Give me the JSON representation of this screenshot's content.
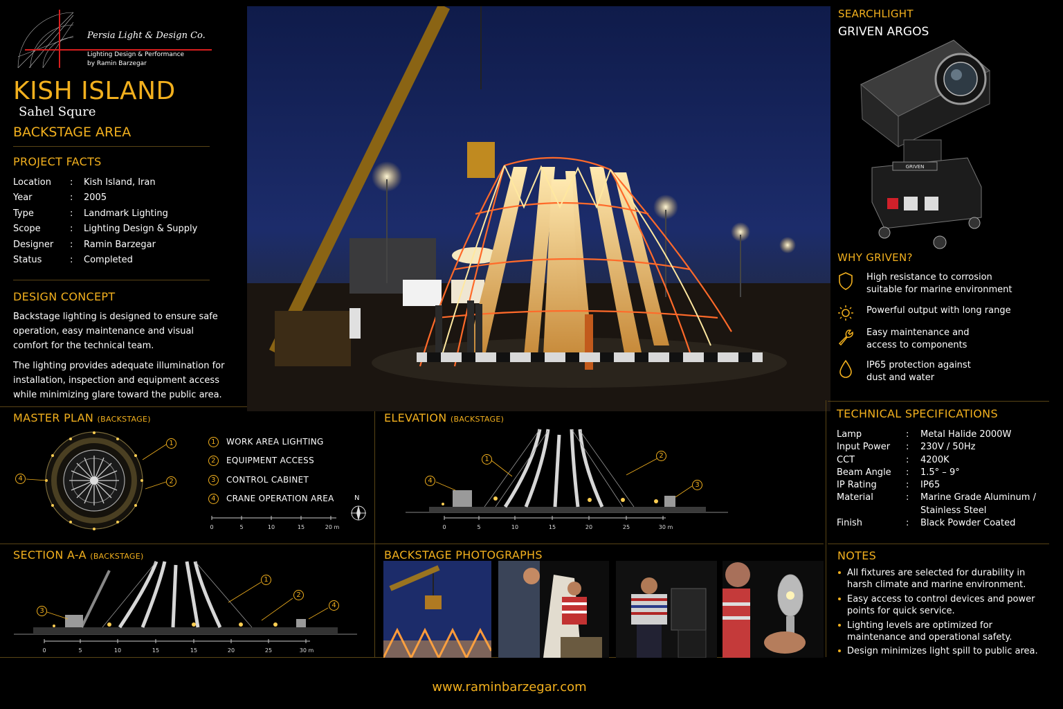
{
  "logo": {
    "company": "Persia Light & Design Co.",
    "tagline1": "Lighting Design & Performance",
    "tagline2": "by Ramin Barzegar"
  },
  "project": {
    "title": "KISH ISLAND",
    "subtitle": "Sahel Squre",
    "area": "BACKSTAGE AREA"
  },
  "facts": {
    "heading": "PROJECT FACTS",
    "rows": [
      {
        "key": "Location",
        "value": "Kish Island, Iran"
      },
      {
        "key": "Year",
        "value": "2005"
      },
      {
        "key": "Type",
        "value": "Landmark Lighting"
      },
      {
        "key": "Scope",
        "value": "Lighting Design & Supply"
      },
      {
        "key": "Designer",
        "value": "Ramin Barzegar"
      },
      {
        "key": "Status",
        "value": "Completed"
      }
    ]
  },
  "concept": {
    "heading": "DESIGN CONCEPT",
    "p1": "Backstage lighting is designed to ensure safe operation, easy maintenance and visual comfort for the technical team.",
    "p2": "The lighting provides adequate illumination for installation, inspection and equipment access while minimizing glare toward the public area."
  },
  "product": {
    "category": "SEARCHLIGHT",
    "name": "GRIVEN ARGOS",
    "brand_mark": "GRIVEN"
  },
  "why": {
    "heading": "WHY GRIVEN?",
    "items": [
      {
        "icon": "shield-icon",
        "l1": "High resistance to corrosion",
        "l2": "suitable for marine environment"
      },
      {
        "icon": "sun-icon",
        "l1": "Powerful output with long range",
        "l2": ""
      },
      {
        "icon": "wrench-icon",
        "l1": "Easy maintenance and",
        "l2": "access to components"
      },
      {
        "icon": "water-drop-icon",
        "l1": "IP65 protection against",
        "l2": "dust and water"
      }
    ]
  },
  "specs": {
    "heading": "TECHNICAL SPECIFICATIONS",
    "rows": [
      {
        "key": "Lamp",
        "value": "Metal Halide 2000W"
      },
      {
        "key": "Input Power",
        "value": "230V / 50Hz"
      },
      {
        "key": "CCT",
        "value": "4200K"
      },
      {
        "key": "Beam Angle",
        "value": "1.5° – 9°"
      },
      {
        "key": "IP Rating",
        "value": "IP65"
      },
      {
        "key": "Material",
        "value": "Marine Grade Aluminum / Stainless Steel"
      },
      {
        "key": "Finish",
        "value": "Black Powder Coated"
      }
    ]
  },
  "notes": {
    "heading": "NOTES",
    "items": [
      "All fixtures are selected for durability in harsh climate and marine environment.",
      "Easy access to control devices and power points for quick service.",
      "Lighting levels are optimized for maintenance and operational safety.",
      "Design minimizes light spill to public area."
    ]
  },
  "master_plan": {
    "heading": "MASTER PLAN",
    "tag": "(BACKSTAGE)",
    "north": "N",
    "callouts": [
      "1",
      "2",
      "4"
    ],
    "legend": [
      {
        "num": "1",
        "label": "WORK AREA LIGHTING"
      },
      {
        "num": "2",
        "label": "EQUIPMENT ACCESS"
      },
      {
        "num": "3",
        "label": "CONTROL CABINET"
      },
      {
        "num": "4",
        "label": "CRANE OPERATION AREA"
      }
    ],
    "scale": [
      "0",
      "5",
      "10",
      "15",
      "20 m"
    ]
  },
  "elevation": {
    "heading": "ELEVATION",
    "tag": "(BACKSTAGE)",
    "callouts": [
      "1",
      "2",
      "4",
      "3"
    ],
    "scale": [
      "0",
      "5",
      "10",
      "15",
      "20",
      "25",
      "30 m"
    ]
  },
  "section": {
    "heading": "SECTION A-A",
    "tag": "(BACKSTAGE)",
    "callouts": [
      "1",
      "2",
      "3",
      "4"
    ],
    "scale": [
      "0",
      "5",
      "10",
      "15",
      "15",
      "20",
      "25",
      "30 m"
    ]
  },
  "photos": {
    "heading": "BACKSTAGE PHOTOGRAPHS"
  },
  "footer": {
    "url": "www.raminbarzegar.com"
  },
  "colors": {
    "accent": "#f2b01e",
    "background": "#000000",
    "rule": "#5a4516"
  }
}
